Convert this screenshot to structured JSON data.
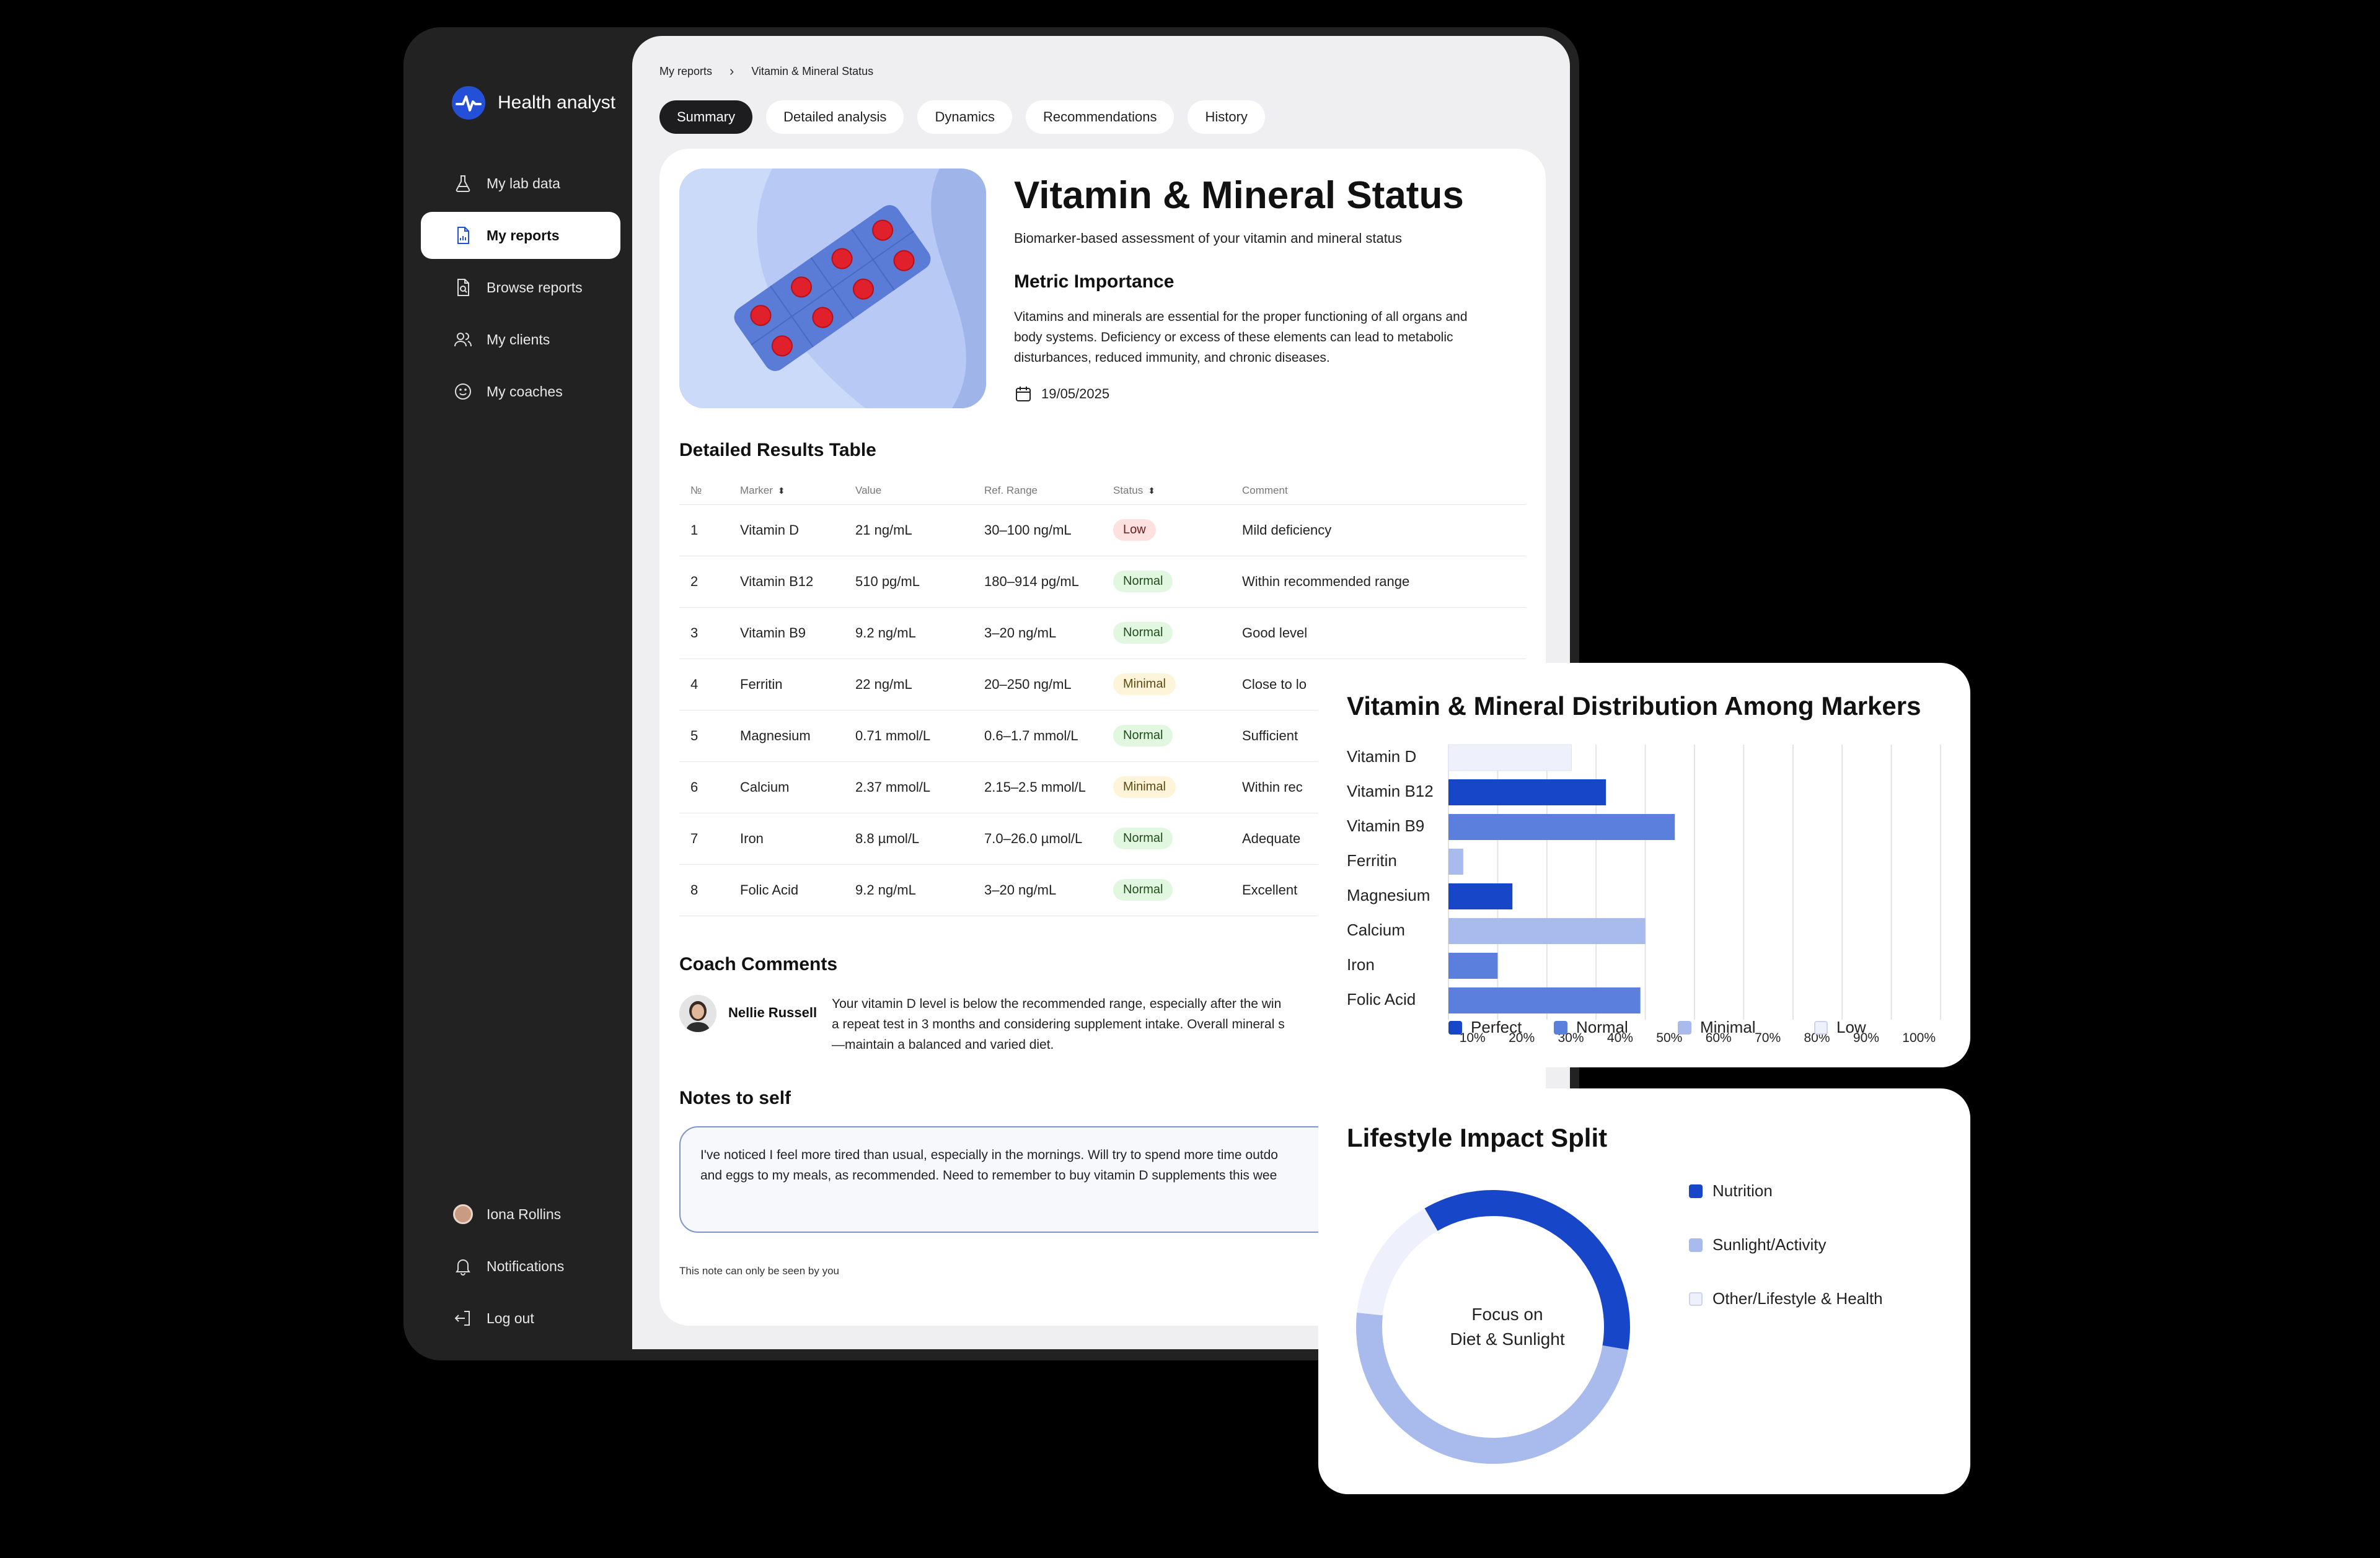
{
  "app": {
    "name": "Health analyst"
  },
  "nav": {
    "items": [
      {
        "label": "My lab data",
        "icon": "flask-icon"
      },
      {
        "label": "My reports",
        "icon": "report-icon",
        "active": true
      },
      {
        "label": "Browse reports",
        "icon": "search-document-icon"
      },
      {
        "label": "My clients",
        "icon": "users-icon"
      },
      {
        "label": "My coaches",
        "icon": "smile-icon"
      }
    ],
    "bottom": [
      {
        "label": "Iona Rollins",
        "icon": "avatar"
      },
      {
        "label": "Notifications",
        "icon": "bell-icon"
      },
      {
        "label": "Log out",
        "icon": "logout-icon"
      }
    ]
  },
  "breadcrumb": {
    "root": "My reports",
    "current": "Vitamin & Mineral Status"
  },
  "tabs": [
    "Summary",
    "Detailed analysis",
    "Dynamics",
    "Recommendations",
    "History"
  ],
  "report": {
    "title": "Vitamin & Mineral Status",
    "subtitle": "Biomarker-based assessment of your vitamin and mineral status",
    "metric_heading": "Metric Importance",
    "metric_text": "Vitamins and minerals are essential for the proper functioning of all organs and body systems. Deficiency or excess of these elements can lead to metabolic disturbances, reduced immunity, and chronic diseases.",
    "date": "19/05/2025"
  },
  "table": {
    "heading": "Detailed Results Table",
    "columns": [
      "№",
      "Marker",
      "Value",
      "Ref. Range",
      "Status",
      "Comment"
    ],
    "rows": [
      [
        "1",
        "Vitamin D",
        "21 ng/mL",
        "30–100 ng/mL",
        "Low",
        "Mild deficiency"
      ],
      [
        "2",
        "Vitamin B12",
        "510 pg/mL",
        "180–914 pg/mL",
        "Normal",
        "Within recommended range"
      ],
      [
        "3",
        "Vitamin B9",
        "9.2 ng/mL",
        "3–20 ng/mL",
        "Normal",
        "Good level"
      ],
      [
        "4",
        "Ferritin",
        "22 ng/mL",
        "20–250 ng/mL",
        "Minimal",
        "Close to lo"
      ],
      [
        "5",
        "Magnesium",
        "0.71 mmol/L",
        "0.6–1.7 mmol/L",
        "Normal",
        "Sufficient"
      ],
      [
        "6",
        "Calcium",
        "2.37 mmol/L",
        "2.15–2.5 mmol/L",
        "Minimal",
        "Within rec"
      ],
      [
        "7",
        "Iron",
        "8.8 µmol/L",
        "7.0–26.0 µmol/L",
        "Normal",
        "Adequate"
      ],
      [
        "8",
        "Folic Acid",
        "9.2 ng/mL",
        "3–20 ng/mL",
        "Normal",
        "Excellent"
      ]
    ]
  },
  "coach": {
    "heading": "Coach Comments",
    "name": "Nellie Russell",
    "text": "Your vitamin D level is below the recommended range, especially after the win\na repeat test in 3 months and considering supplement intake. Overall mineral s\n—maintain a balanced and varied diet."
  },
  "notes": {
    "heading": "Notes to self",
    "text": "I've noticed I feel more tired than usual, especially in the mornings. Will try to spend more time outdo\nand eggs to my meals, as recommended. Need to remember to buy vitamin D supplements this wee",
    "hint": "This note can only be seen by you"
  },
  "colors": {
    "perfect": "#1747c8",
    "normal": "#5a7fdd",
    "minimal": "#a9bbed",
    "low": "#eef1fb",
    "accent": "#2450d8"
  },
  "chart_data": [
    {
      "type": "bar",
      "orientation": "horizontal",
      "title": "Vitamin & Mineral Distribution Among Markers",
      "categories": [
        "Vitamin D",
        "Vitamin B12",
        "Vitamin B9",
        "Ferritin",
        "Magnesium",
        "Calcium",
        "Iron",
        "Folic Acid"
      ],
      "values": [
        25,
        32,
        46,
        3,
        13,
        40,
        10,
        39
      ],
      "status": [
        "Low",
        "Perfect",
        "Normal",
        "Minimal",
        "Perfect",
        "Minimal",
        "Normal",
        "Normal"
      ],
      "x_ticks": [
        "10%",
        "20%",
        "30%",
        "40%",
        "50%",
        "60%",
        "70%",
        "80%",
        "90%",
        "100%"
      ],
      "xlim": [
        0,
        100
      ],
      "grid": true,
      "legend": [
        "Perfect",
        "Normal",
        "Minimal",
        "Low"
      ],
      "legend_position": "bottom"
    },
    {
      "type": "pie",
      "style": "donut",
      "title": "Lifestyle Impact Split",
      "center_text": "Focus on\nDiet & Sunlight",
      "slices": [
        {
          "name": "Nutrition",
          "value": 36
        },
        {
          "name": "Sunlight/Activity",
          "value": 49
        },
        {
          "name": "Other/Lifestyle & Health",
          "value": 15
        }
      ],
      "legend_position": "right"
    }
  ]
}
